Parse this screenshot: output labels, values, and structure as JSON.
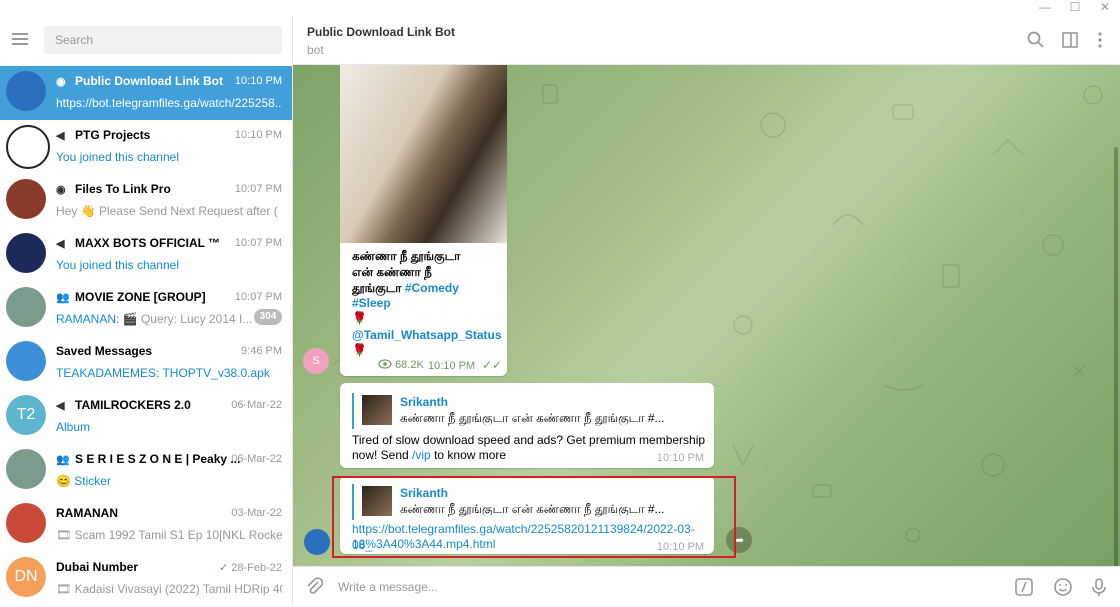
{
  "window": {
    "minimize": "—",
    "maximize": "☐",
    "close": "✕"
  },
  "search": {
    "placeholder": "Search"
  },
  "chats": [
    {
      "name": "Public Download Link Bot",
      "time": "10:10 PM",
      "preview": "https://bot.telegramfiles.ga/watch/225258...",
      "type": "bot",
      "avatar_color": "#2c6fbf",
      "active": true,
      "preview_blue": false
    },
    {
      "name": "PTG Projects",
      "time": "10:10 PM",
      "preview": "You joined this channel",
      "type": "channel",
      "avatar_color": "#ffffff",
      "preview_blue": true
    },
    {
      "name": "Files To Link Pro",
      "time": "10:07 PM",
      "preview": "Hey 👋 Please Send Next Request after ( ...",
      "type": "bot",
      "avatar_color": "#8a3a28",
      "preview_blue": false
    },
    {
      "name": "MAXX BOTS OFFICIAL ™",
      "time": "10:07 PM",
      "preview": "You joined this channel",
      "type": "channel",
      "avatar_color": "#1c2a5a",
      "preview_blue": true
    },
    {
      "name": "MOVIE ZONE [GROUP]",
      "time": "10:07 PM",
      "preview_sender": "RAMANAN:",
      "preview": "🎬 Query: Lucy 2014   I...",
      "type": "group",
      "avatar_color": "#7a9a8c",
      "badge": "304",
      "preview_blue": false
    },
    {
      "name": "Saved Messages",
      "time": "9:46 PM",
      "preview": "TEAKADAMEMES: THOPTV_v38.0.apk",
      "type": "",
      "avatar_color": "#3d8fd8",
      "preview_blue": true
    },
    {
      "name": "TAMILROCKERS 2.0",
      "time": "06-Mar-22",
      "preview": "Album",
      "type": "channel",
      "avatar_color": "#5eb5d0",
      "avatar_text": "T2",
      "preview_blue": true
    },
    {
      "name": "S E R I E S Z O N E | Peaky ...",
      "time": "06-Mar-22",
      "preview": "😊 Sticker",
      "type": "group",
      "avatar_color": "#7a9a8c",
      "preview_blue": true
    },
    {
      "name": "RAMANAN",
      "time": "03-Mar-22",
      "preview": "🎞 Scam 1992 Tamil S1 Ep 10[NKL Rockers...",
      "type": "",
      "avatar_color": "#c94a3a",
      "preview_blue": false
    },
    {
      "name": "Dubai Number",
      "time": "28-Feb-22",
      "preview": "🎞 Kadaisi Vivasayi (2022) Tamil HDRip 40...",
      "type": "",
      "avatar_color": "#f5a05a",
      "avatar_text": "DN",
      "preview_blue": false,
      "read_check": "✓"
    }
  ],
  "header": {
    "title": "Public Download Link Bot",
    "subtitle": "bot"
  },
  "messages": {
    "post": {
      "line1": "கண்ணா நீ தூங்குடா",
      "line2": "என் கண்ணா நீ",
      "line3": "தூங்குடா",
      "hashtag1": "#Comedy",
      "hashtag2": "#Sleep",
      "rose": "🌹",
      "mention": "@Tamil_Whatsapp_Status",
      "views": "68.2K",
      "time": "10:10 PM",
      "sender_initial": "S"
    },
    "reply1": {
      "reply_name": "Srikanth",
      "reply_text": "கண்ணா நீ தூங்குடா என் கண்ணா நீ தூங்குடா #...",
      "line1": "Tired of slow download speed and ads? Get premium membership",
      "line2_pre": "now! Send ",
      "line2_link": "/vip",
      "line2_post": " to know more",
      "time": "10:10 PM"
    },
    "reply2": {
      "reply_name": "Srikanth",
      "reply_text": "கண்ணா நீ தூங்குடா என் கண்ணா நீ தூங்குடா #...",
      "link_line1": "https://bot.telegramfiles.ga/watch/22525820121139824/2022-03-08_",
      "link_line2": "16%3A40%3A44.mp4.html",
      "time": "10:10 PM"
    }
  },
  "composer": {
    "placeholder": "Write a message..."
  },
  "colors": {
    "accent": "#419fd9",
    "link": "#168acd",
    "highlight": "#d42020"
  }
}
